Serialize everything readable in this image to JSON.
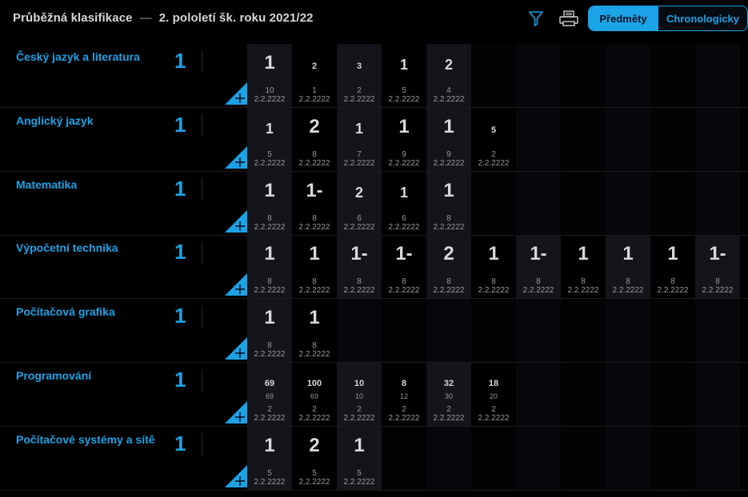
{
  "header": {
    "title": "Průběžná klasifikace",
    "separator": "—",
    "period": "2. pololetí šk. roku 2021/22",
    "view_subjects": "Předměty",
    "view_chronological": "Chronologicky",
    "accent_color": "#1aa3e6"
  },
  "subjects": [
    {
      "name": "Český jazyk a literatura",
      "average": "1",
      "marks": [
        {
          "grade": "1",
          "size": "big",
          "weight": "10",
          "date": "2.2.2222"
        },
        {
          "grade": "2",
          "size": "sm",
          "weight": "1",
          "date": "2.2.2222"
        },
        {
          "grade": "3",
          "size": "sm",
          "weight": "2",
          "date": "2.2.2222"
        },
        {
          "grade": "1",
          "size": "mid",
          "weight": "5",
          "date": "2.2.2222"
        },
        {
          "grade": "2",
          "size": "mid",
          "weight": "4",
          "date": "2.2.2222"
        }
      ]
    },
    {
      "name": "Anglický jazyk",
      "average": "1",
      "marks": [
        {
          "grade": "1",
          "size": "mid",
          "weight": "5",
          "date": "2.2.2222"
        },
        {
          "grade": "2",
          "size": "big",
          "weight": "8",
          "date": "2.2.2222"
        },
        {
          "grade": "1",
          "size": "mid",
          "weight": "7",
          "date": "2.2.2222"
        },
        {
          "grade": "1",
          "size": "big",
          "weight": "9",
          "date": "2.2.2222"
        },
        {
          "grade": "1",
          "size": "big",
          "weight": "9",
          "date": "2.2.2222"
        },
        {
          "grade": "5",
          "size": "sm",
          "weight": "2",
          "date": "2.2.2222"
        }
      ]
    },
    {
      "name": "Matematika",
      "average": "1",
      "marks": [
        {
          "grade": "1",
          "size": "big",
          "weight": "8",
          "date": "2.2.2222"
        },
        {
          "grade": "1-",
          "size": "big",
          "weight": "8",
          "date": "2.2.2222"
        },
        {
          "grade": "2",
          "size": "mid",
          "weight": "6",
          "date": "2.2.2222"
        },
        {
          "grade": "1",
          "size": "mid",
          "weight": "6",
          "date": "2.2.2222"
        },
        {
          "grade": "1",
          "size": "big",
          "weight": "8",
          "date": "2.2.2222"
        }
      ]
    },
    {
      "name": "Výpočetní technika",
      "average": "1",
      "marks": [
        {
          "grade": "1",
          "size": "big",
          "weight": "8",
          "date": "2.2.2222"
        },
        {
          "grade": "1",
          "size": "big",
          "weight": "8",
          "date": "2.2.2222"
        },
        {
          "grade": "1-",
          "size": "big",
          "weight": "8",
          "date": "2.2.2222"
        },
        {
          "grade": "1-",
          "size": "big",
          "weight": "8",
          "date": "2.2.2222"
        },
        {
          "grade": "2",
          "size": "big",
          "weight": "8",
          "date": "2.2.2222"
        },
        {
          "grade": "1",
          "size": "big",
          "weight": "8",
          "date": "2.2.2222"
        },
        {
          "grade": "1-",
          "size": "big",
          "weight": "8",
          "date": "2.2.2222"
        },
        {
          "grade": "1",
          "size": "big",
          "weight": "8",
          "date": "2.2.2222"
        },
        {
          "grade": "1",
          "size": "big",
          "weight": "8",
          "date": "2.2.2222"
        },
        {
          "grade": "1",
          "size": "big",
          "weight": "8",
          "date": "2.2.2222"
        },
        {
          "grade": "1-",
          "size": "big",
          "weight": "8",
          "date": "2.2.2222"
        }
      ]
    },
    {
      "name": "Počítačová grafika",
      "average": "1",
      "marks": [
        {
          "grade": "1",
          "size": "big",
          "weight": "8",
          "date": "2.2.2222"
        },
        {
          "grade": "1",
          "size": "big",
          "weight": "8",
          "date": "2.2.2222"
        }
      ]
    },
    {
      "name": "Programování",
      "average": "1",
      "marks": [
        {
          "grade": "69",
          "size": "num",
          "sub": "69",
          "weight": "2",
          "date": "2.2.2222"
        },
        {
          "grade": "100",
          "size": "num",
          "sub": "69",
          "weight": "2",
          "date": "2.2.2222"
        },
        {
          "grade": "10",
          "size": "num",
          "sub": "10",
          "weight": "2",
          "date": "2.2.2222"
        },
        {
          "grade": "8",
          "size": "num",
          "sub": "12",
          "weight": "2",
          "date": "2.2.2222"
        },
        {
          "grade": "32",
          "size": "num",
          "sub": "30",
          "weight": "2",
          "date": "2.2.2222"
        },
        {
          "grade": "18",
          "size": "num",
          "sub": "20",
          "weight": "2",
          "date": "2.2.2222"
        }
      ]
    },
    {
      "name": "Počítačové systémy a sítě",
      "average": "1",
      "marks": [
        {
          "grade": "1",
          "size": "big",
          "weight": "5",
          "date": "2.2.2222"
        },
        {
          "grade": "2",
          "size": "big",
          "weight": "5",
          "date": "2.2.2222"
        },
        {
          "grade": "1",
          "size": "big",
          "weight": "5",
          "date": "2.2.2222"
        }
      ]
    }
  ]
}
